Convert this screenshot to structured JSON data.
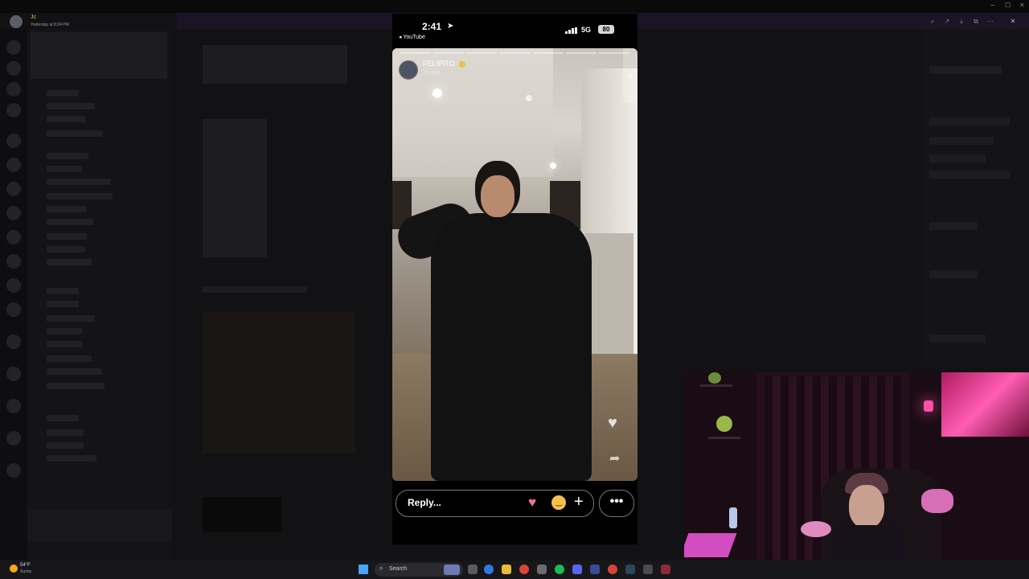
{
  "notification": {
    "name": "Jc",
    "time": "Yesterday at 8:24 PM"
  },
  "phone": {
    "status_time": "2:41",
    "back_app": "◂ YouTube",
    "network": "5G",
    "battery": "80",
    "story": {
      "username": "FELIPITO",
      "age": "7h ago",
      "segments": 7
    },
    "reply_placeholder": "Reply...",
    "more_label": "•••"
  },
  "taskbar": {
    "weather_temp": "54°F",
    "weather_cond": "Sunny",
    "search_label": "Search"
  },
  "colors": {
    "accent_heart": "#f16fa3",
    "verified": "#e6c34a",
    "battery_bg": "#d8d8d8"
  }
}
